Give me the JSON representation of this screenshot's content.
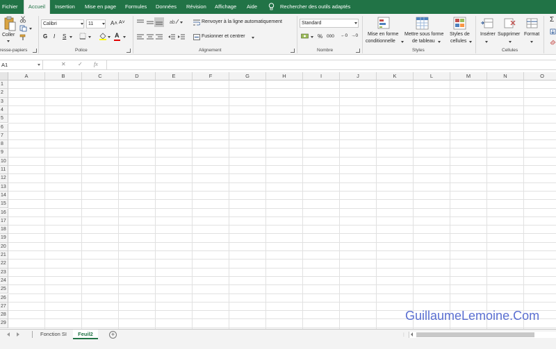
{
  "ribbon_tabs": [
    "Fichier",
    "Accueil",
    "Insertion",
    "Mise en page",
    "Formules",
    "Données",
    "Révision",
    "Affichage",
    "Aide"
  ],
  "tell_me": "Rechercher des outils adaptés",
  "clipboard": {
    "paste_label": "Coller",
    "group_label": "resse-papiers"
  },
  "font": {
    "name": "Calibri",
    "size": "11",
    "group_label": "Police",
    "bold": "G",
    "italic": "I",
    "underline": "S"
  },
  "alignment": {
    "wrap_label": "Renvoyer à la ligne automatiquement",
    "merge_label": "Fusionner et centrer",
    "group_label": "Alignement"
  },
  "number": {
    "format": "Standard",
    "group_label": "Nombre",
    "percent": "%",
    "thousands": "000"
  },
  "styles": {
    "conditional_line1": "Mise en forme",
    "conditional_line2": "conditionnelle",
    "table_line1": "Mettre sous forme",
    "table_line2": "de tableau",
    "cell_line1": "Styles de",
    "cell_line2": "cellules",
    "group_label": "Styles"
  },
  "cells": {
    "insert": "Insérer",
    "delete": "Supprimer",
    "format": "Format",
    "group_label": "Cellules"
  },
  "formula_bar": {
    "name_box": "A1",
    "fx": "fx",
    "cancel": "✕",
    "enter": "✓",
    "value": ""
  },
  "columns": [
    "A",
    "B",
    "C",
    "D",
    "E",
    "F",
    "G",
    "H",
    "I",
    "J",
    "K",
    "L",
    "M",
    "N",
    "O"
  ],
  "rows": [
    "1",
    "2",
    "3",
    "4",
    "5",
    "6",
    "7",
    "8",
    "9",
    "10",
    "11",
    "12",
    "13",
    "14",
    "15",
    "16",
    "17",
    "18",
    "19",
    "20",
    "21",
    "22",
    "23",
    "24",
    "25",
    "26",
    "27",
    "28",
    "29"
  ],
  "sheets": [
    "Fonction SI",
    "Feuil2"
  ],
  "active_sheet": "Feuil2",
  "watermark": "GuillaumeLemoine.Com",
  "colors": {
    "accent": "#217346",
    "watermark": "#5a6fd1"
  }
}
